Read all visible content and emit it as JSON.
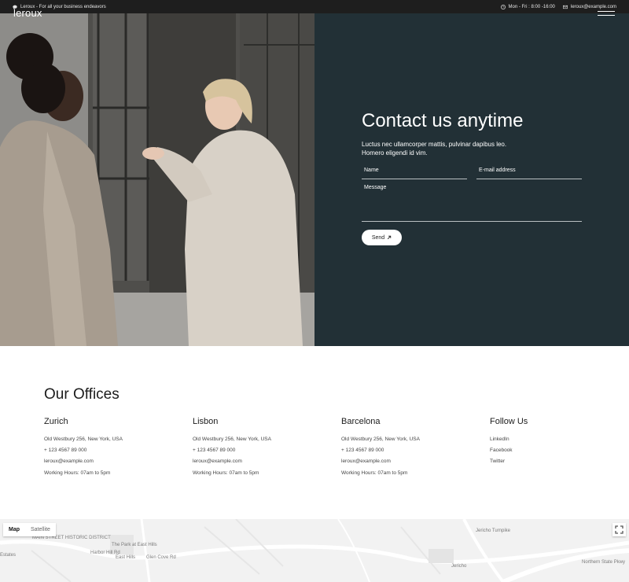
{
  "topbar": {
    "tagline": "Leroux - For all your business endeavors",
    "hours": "Mon - Fri : 8:00 -16:00",
    "email": "leroux@example.com"
  },
  "header": {
    "logo": "leroux"
  },
  "contact": {
    "title": "Contact us anytime",
    "subtitle": "Luctus nec ullamcorper mattis, pulvinar dapibus leo. Homero eligendi id vim.",
    "name_placeholder": "Name",
    "email_placeholder": "E-mail address",
    "message_placeholder": "Message",
    "send_label": "Send",
    "send_icon": "arrow-up-right-icon"
  },
  "offices": {
    "title": "Our Offices",
    "items": [
      {
        "city": "Zurich",
        "address": "Old Westbury 256, New York, USA",
        "phone": "+ 123 4567 89 000",
        "email": "leroux@example.com",
        "hours": "Working Hours: 07am to 5pm"
      },
      {
        "city": "Lisbon",
        "address": "Old Westbury 256, New York, USA",
        "phone": "+ 123 4567 89 000",
        "email": "leroux@example.com",
        "hours": "Working Hours: 07am to 5pm"
      },
      {
        "city": "Barcelona",
        "address": "Old Westbury 256, New York, USA",
        "phone": "+ 123 4567 89 000",
        "email": "leroux@example.com",
        "hours": "Working Hours: 07am to 5pm"
      }
    ],
    "follow": {
      "title": "Follow Us",
      "links": [
        "LinkedIn",
        "Facebook",
        "Twitter"
      ]
    }
  },
  "map": {
    "tabs": [
      "Map",
      "Satellite"
    ],
    "labels": [
      "MAIN STREET HISTORIC DISTRICT",
      "The Park at East Hills",
      "East Hills",
      "Estates",
      "Jericho",
      "Northern State Pkwy",
      "Harbor Hill Rd",
      "Jericho Turnpike",
      "Glen Cove Rd"
    ]
  },
  "colors": {
    "panel": "#223036",
    "topbar": "#1e1e1e"
  }
}
